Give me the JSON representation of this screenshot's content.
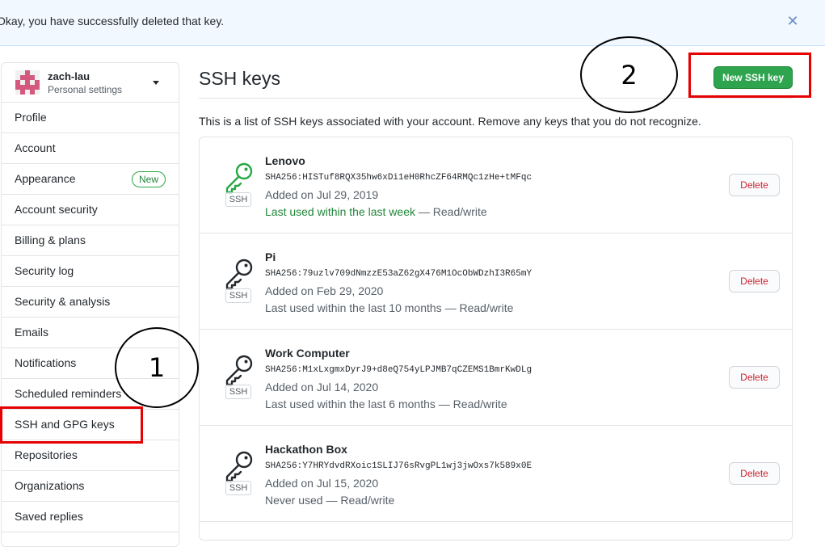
{
  "flash": {
    "message": "Okay, you have successfully deleted that key.",
    "close_icon": "close-icon"
  },
  "sidebar": {
    "user": {
      "name": "zach-lau",
      "subtitle": "Personal settings",
      "avatar_icon": "avatar-identicon"
    },
    "items": [
      {
        "label": "Profile"
      },
      {
        "label": "Account"
      },
      {
        "label": "Appearance",
        "badge": "New"
      },
      {
        "label": "Account security"
      },
      {
        "label": "Billing & plans"
      },
      {
        "label": "Security log"
      },
      {
        "label": "Security & analysis"
      },
      {
        "label": "Emails"
      },
      {
        "label": "Notifications"
      },
      {
        "label": "Scheduled reminders"
      },
      {
        "label": "SSH and GPG keys",
        "selected": true
      },
      {
        "label": "Repositories"
      },
      {
        "label": "Organizations"
      },
      {
        "label": "Saved replies"
      }
    ]
  },
  "main": {
    "title": "SSH keys",
    "new_key_label": "New SSH key",
    "intro": "This is a list of SSH keys associated with your account. Remove any keys that you do not recognize.",
    "keys": [
      {
        "name": "Lenovo",
        "fingerprint": "SHA256:HISTuf8RQX35hw6xDi1eH0RhcZF64RMQc1zHe+tMFqc",
        "added": "Added on Jul 29, 2019",
        "last_used": "Last used within the last week",
        "last_used_recent": true,
        "access": " — Read/write",
        "type_label": "SSH",
        "delete_label": "Delete",
        "icon_color": "#28a745"
      },
      {
        "name": "Pi",
        "fingerprint": "SHA256:79uzlv709dNmzzE53aZ62gX476M1OcObWDzhI3R65mY",
        "added": "Added on Feb 29, 2020",
        "last_used": "Last used within the last 10 months",
        "last_used_recent": false,
        "access": " — Read/write",
        "type_label": "SSH",
        "delete_label": "Delete",
        "icon_color": "#24292e"
      },
      {
        "name": "Work Computer",
        "fingerprint": "SHA256:M1xLxgmxDyrJ9+d8eQ754yLPJMB7qCZEMS1BmrKwDLg",
        "added": "Added on Jul 14, 2020",
        "last_used": "Last used within the last 6 months",
        "last_used_recent": false,
        "access": " — Read/write",
        "type_label": "SSH",
        "delete_label": "Delete",
        "icon_color": "#24292e"
      },
      {
        "name": "Hackathon Box",
        "fingerprint": "SHA256:Y7HRYdvdRXoic1SLIJ76sRvgPL1wj3jwOxs7k589x0E",
        "added": "Added on Jul 15, 2020",
        "last_used": "Never used",
        "last_used_recent": false,
        "access": " — Read/write",
        "type_label": "SSH",
        "delete_label": "Delete",
        "icon_color": "#24292e"
      }
    ]
  },
  "annotations": {
    "step1": "1",
    "step2": "2",
    "highlight_color": "#e60000"
  }
}
